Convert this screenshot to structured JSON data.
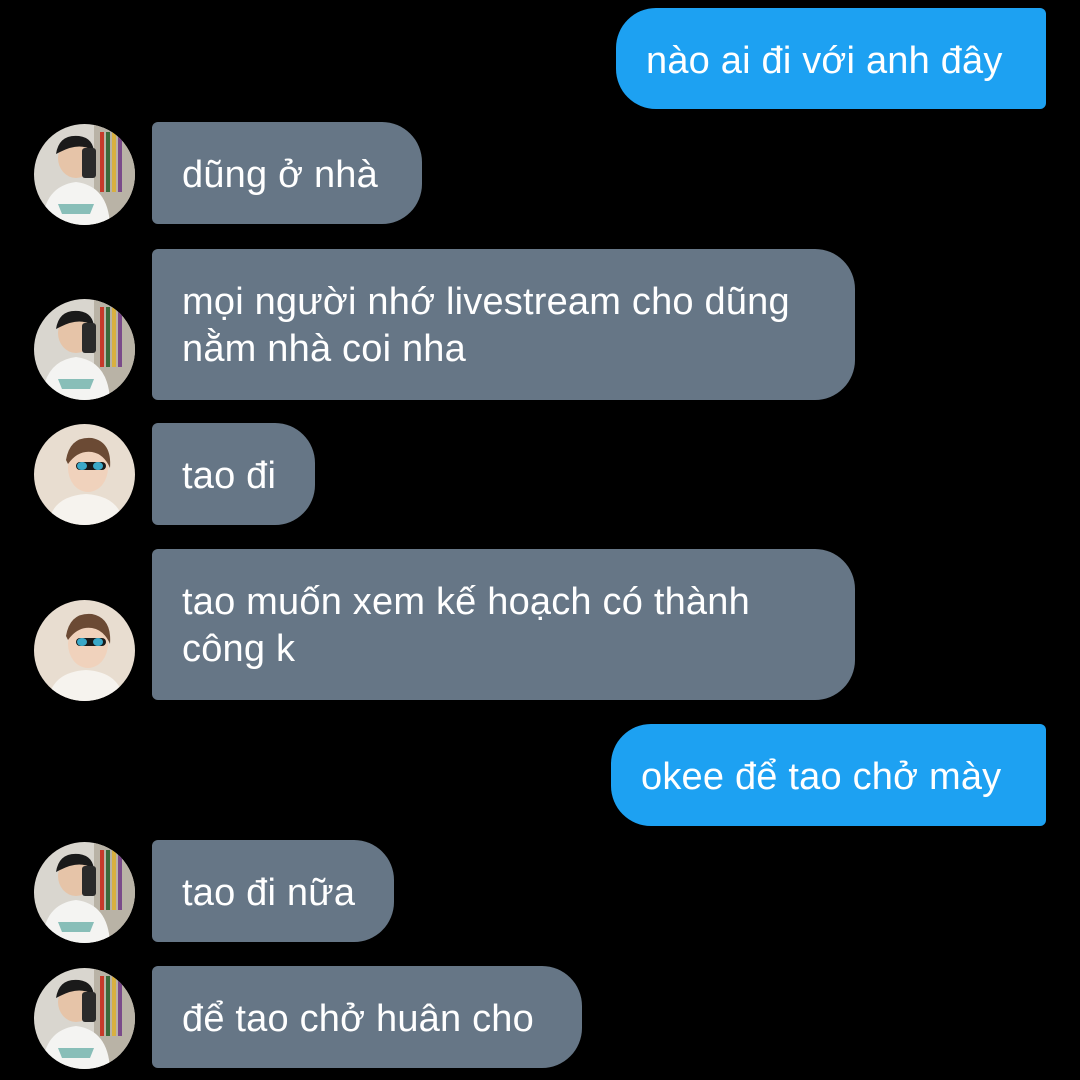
{
  "conversation": {
    "messages": [
      {
        "direction": "out",
        "sender": "me",
        "text": "nào ai đi với anh đây"
      },
      {
        "direction": "in",
        "sender": "user_a",
        "text": "dũng ở nhà"
      },
      {
        "direction": "in",
        "sender": "user_a",
        "lines": [
          "mọi người nhớ livestream cho dũng",
          "nằm nhà coi nha"
        ]
      },
      {
        "direction": "in",
        "sender": "user_b",
        "text": "tao đi"
      },
      {
        "direction": "in",
        "sender": "user_b",
        "lines": [
          "tao muốn xem kế hoạch có thành",
          "công k"
        ]
      },
      {
        "direction": "out",
        "sender": "me",
        "text": "okee để tao chở mày"
      },
      {
        "direction": "in",
        "sender": "user_a",
        "text": "tao đi nữa"
      },
      {
        "direction": "in",
        "sender": "user_a",
        "text": "để tao chở huân cho"
      }
    ]
  },
  "avatars": {
    "user_a": {
      "icon": "avatar-mirror-selfie-photo"
    },
    "user_b": {
      "icon": "avatar-sunglasses-profile-photo"
    }
  },
  "colors": {
    "background": "#000000",
    "incoming_bubble": "#667686",
    "outgoing_bubble": "#1da1f2",
    "text": "#ffffff"
  }
}
